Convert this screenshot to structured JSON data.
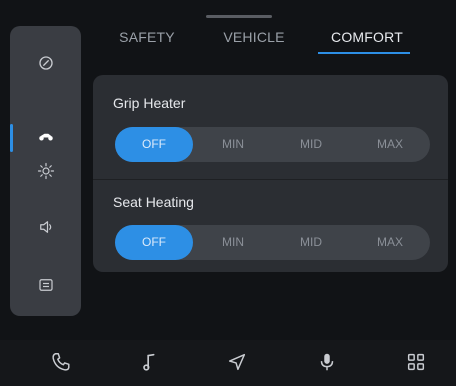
{
  "tabs": [
    {
      "label": "SAFETY"
    },
    {
      "label": "VEHICLE"
    },
    {
      "label": "COMFORT"
    }
  ],
  "active_tab": "COMFORT",
  "sidebar": {
    "items": [
      "speedometer-icon",
      "motorcycle-icon",
      "brightness-icon",
      "volume-icon",
      "message-icon"
    ],
    "active_item": "motorcycle-icon"
  },
  "grip_heater": {
    "title": "Grip Heater",
    "options": [
      "OFF",
      "MIN",
      "MID",
      "MAX"
    ],
    "selected": "OFF"
  },
  "seat_heating": {
    "title": "Seat Heating",
    "options": [
      "OFF",
      "MIN",
      "MID",
      "MAX"
    ],
    "selected": "OFF"
  },
  "bottom_bar": [
    "phone-icon",
    "music-note-icon",
    "navigation-icon",
    "microphone-icon",
    "apps-grid-icon"
  ],
  "colors": {
    "accent": "#2d8fe5",
    "sidebar_bg": "#3a3d43",
    "panel_bg": "#2b2e33",
    "screen_bg": "#111316"
  }
}
